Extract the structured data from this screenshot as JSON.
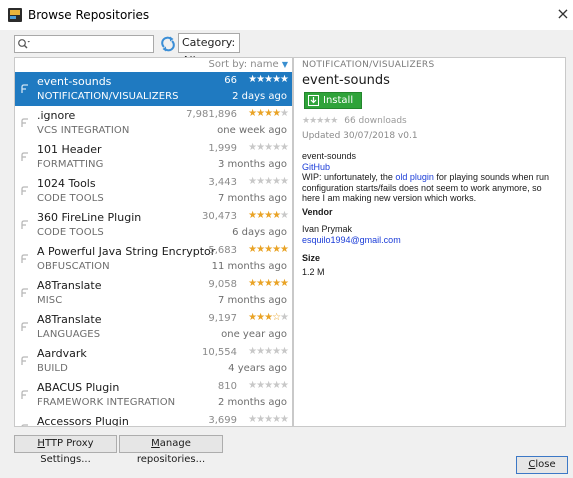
{
  "window": {
    "title": "Browse Repositories",
    "close_glyph": "×"
  },
  "toolbar": {
    "search_value": "",
    "category_label": "Category: All",
    "category_chevron": "⌵"
  },
  "list": {
    "sort_label": "Sort by: name",
    "items": [
      {
        "name": "event-sounds",
        "category": "NOTIFICATION/VISUALIZERS",
        "downloads": "66",
        "rating": 5,
        "date": "2 days ago",
        "selected": true
      },
      {
        "name": ".ignore",
        "category": "VCS INTEGRATION",
        "downloads": "7,981,896",
        "rating": 4,
        "date": "one week ago",
        "selected": false
      },
      {
        "name": "101 Header",
        "category": "FORMATTING",
        "downloads": "1,999",
        "rating": 0,
        "date": "3 months ago",
        "selected": false
      },
      {
        "name": "1024 Tools",
        "category": "CODE TOOLS",
        "downloads": "3,443",
        "rating": 0,
        "date": "7 months ago",
        "selected": false
      },
      {
        "name": "360 FireLine Plugin",
        "category": "CODE TOOLS",
        "downloads": "30,473",
        "rating": 4,
        "date": "6 days ago",
        "selected": false
      },
      {
        "name": "A Powerful Java String Encryptor",
        "category": "OBFUSCATION",
        "downloads": "5,683",
        "rating": 5,
        "date": "11 months ago",
        "selected": false
      },
      {
        "name": "A8Translate",
        "category": "MISC",
        "downloads": "9,058",
        "rating": 5,
        "date": "7 months ago",
        "selected": false
      },
      {
        "name": "A8Translate",
        "category": "LANGUAGES",
        "downloads": "9,197",
        "rating": 3.5,
        "date": "one year ago",
        "selected": false
      },
      {
        "name": "Aardvark",
        "category": "BUILD",
        "downloads": "10,554",
        "rating": 0,
        "date": "4 years ago",
        "selected": false
      },
      {
        "name": "ABACUS Plugin",
        "category": "FRAMEWORK INTEGRATION",
        "downloads": "810",
        "rating": 0,
        "date": "2 months ago",
        "selected": false
      },
      {
        "name": "Accessors Plugin",
        "category": "",
        "downloads": "3,699",
        "rating": 0,
        "date": "",
        "selected": false
      }
    ]
  },
  "detail": {
    "category": "NOTIFICATION/VISUALIZERS",
    "name": "event-sounds",
    "install_label": "Install",
    "downloads_text": "66 downloads",
    "updated_text": "Updated 30/07/2018   v0.1",
    "desc_title": "event-sounds",
    "desc_link": "GitHub",
    "desc_prefix": "WIP: unfortunately, the ",
    "desc_link2": "old plugin",
    "desc_suffix": " for playing sounds when run configuration starts/fails does not seem to work anymore, so here I am making new version which works.",
    "vendor_heading": "Vendor",
    "vendor_name": "Ivan Prymak",
    "vendor_email": "esquilo1994@gmail.com",
    "size_heading": "Size",
    "size_value": "1.2 M"
  },
  "buttons": {
    "proxy_label": "TTP Proxy Settings...",
    "proxy_mnemonic": "H",
    "repos_label": "anage repositories...",
    "repos_mnemonic": "M",
    "close_label": "lose",
    "close_mnemonic": "C"
  },
  "colors": {
    "selection": "#1f7ac1",
    "install": "#2fa33a",
    "star": "#e9a326",
    "link": "#1a3cd8"
  }
}
